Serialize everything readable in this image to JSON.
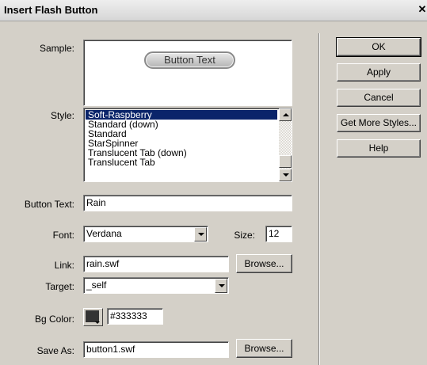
{
  "window": {
    "title": "Insert Flash Button",
    "close_glyph": "✕"
  },
  "sample": {
    "label": "Sample:",
    "button_text": "Button Text"
  },
  "style": {
    "label": "Style:",
    "items": [
      "Soft-Raspberry",
      "Standard (down)",
      "Standard",
      "StarSpinner",
      "Translucent Tab (down)",
      "Translucent Tab"
    ],
    "selected_index": 0
  },
  "button_text": {
    "label": "Button Text:",
    "value": "Rain"
  },
  "font": {
    "label": "Font:",
    "value": "Verdana"
  },
  "size": {
    "label": "Size:",
    "value": "12"
  },
  "link": {
    "label": "Link:",
    "value": "rain.swf",
    "browse_label": "Browse..."
  },
  "target": {
    "label": "Target:",
    "value": "_self"
  },
  "bg_color": {
    "label": "Bg Color:",
    "swatch_color": "#333333",
    "value": "#333333"
  },
  "save_as": {
    "label": "Save As:",
    "value": "button1.swf",
    "browse_label": "Browse..."
  },
  "buttons": {
    "ok": "OK",
    "apply": "Apply",
    "cancel": "Cancel",
    "more_styles": "Get More Styles...",
    "help": "Help"
  },
  "colors": {
    "dialog_bg": "#d4d0c8",
    "selection": "#0a246a"
  }
}
